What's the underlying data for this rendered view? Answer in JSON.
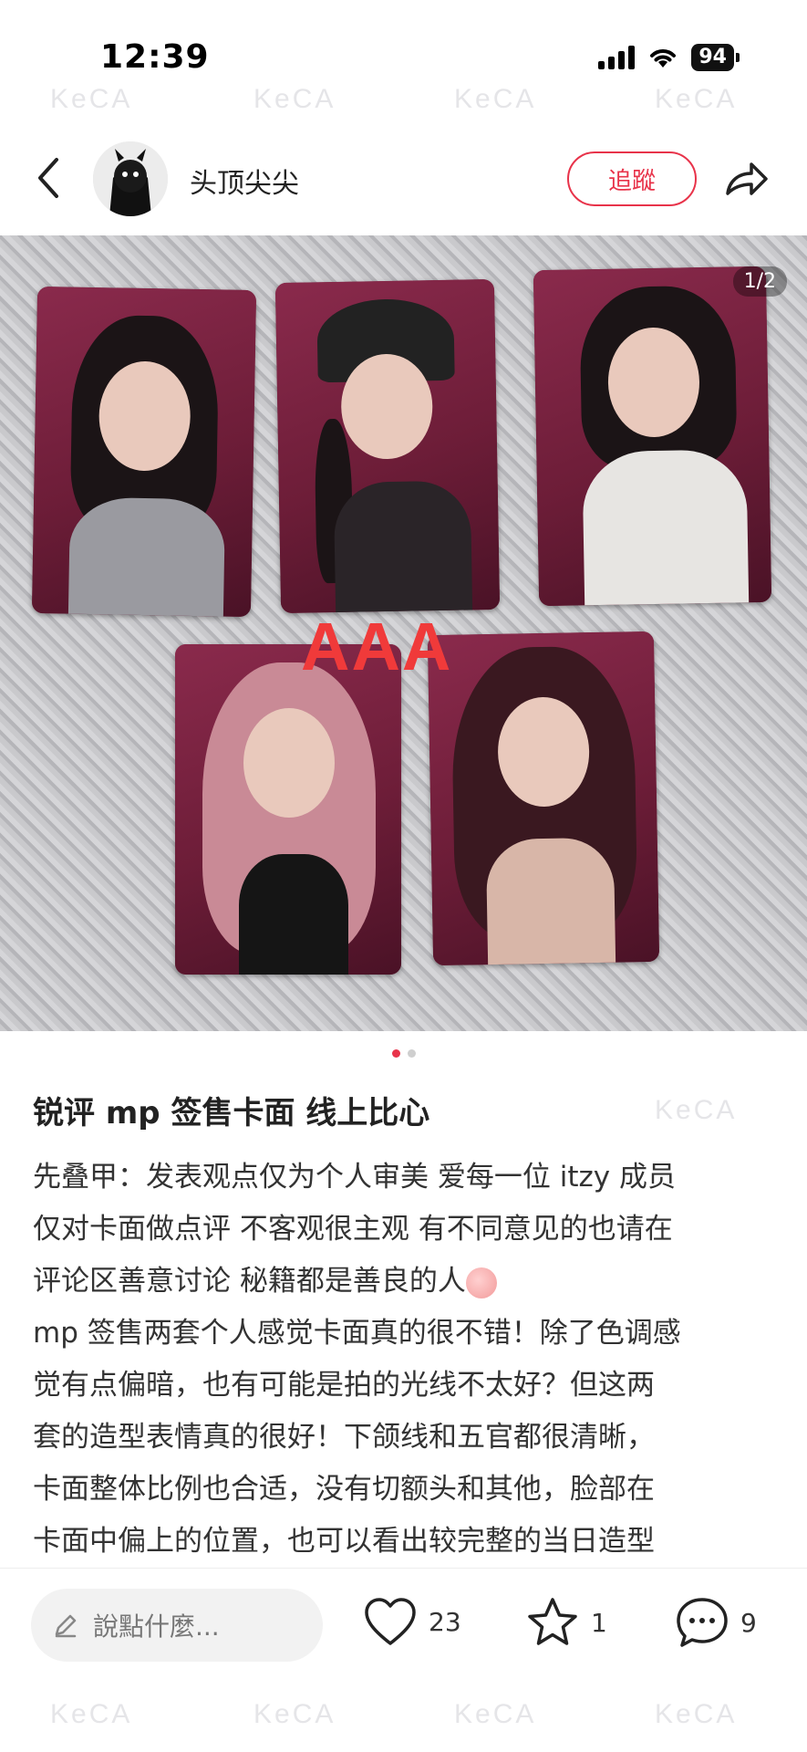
{
  "status_bar": {
    "time": "12:39",
    "battery": "94"
  },
  "header": {
    "author_name": "头顶尖尖",
    "follow_label": "追蹤"
  },
  "photo": {
    "page_indicator": "1/2",
    "overlay_label": "AAA",
    "current_page": 1,
    "total_pages": 2
  },
  "post": {
    "title": "锐评 mp 签售卡面 线上比心",
    "body_lines": [
      "先叠甲：发表观点仅为个人审美 爱每一位 itzy 成员",
      "仅对卡面做点评 不客观很主观 有不同意见的也请在",
      "评论区善意讨论 秘籍都是善良的人",
      "mp 签售两套个人感觉卡面真的很不错！除了色调感",
      "觉有点偏暗，也有可能是拍的光线不太好？但这两",
      "套的造型表情真的很好！下颌线和五官都很清晰，",
      "卡面整体比例也合适，没有切额头和其他，脸部在",
      "卡面中偏上的位置，也可以看出较完整的当日造型"
    ]
  },
  "bottom_bar": {
    "comment_placeholder": "說點什麼...",
    "like_count": "23",
    "favorite_count": "1",
    "comment_count": "9"
  },
  "watermark": "KeCA",
  "colors": {
    "accent": "#e8334a",
    "overlay_text": "#f03a3a"
  }
}
